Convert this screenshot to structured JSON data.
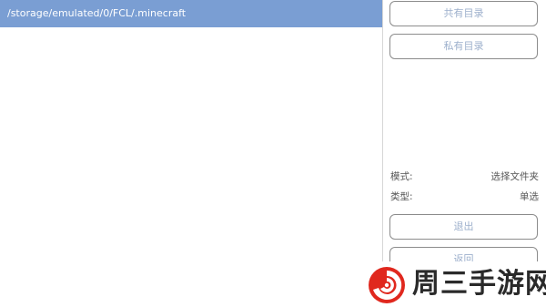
{
  "path_bar": {
    "path": "/storage/emulated/0/FCL/.minecraft"
  },
  "sidebar": {
    "public_dir_label": "共有目录",
    "private_dir_label": "私有目录",
    "mode_key": "模式:",
    "mode_value": "选择文件夹",
    "type_key": "类型:",
    "type_value": "单选",
    "exit_label": "退出",
    "back_label": "返回"
  },
  "watermark": {
    "text": "周三手游网"
  },
  "colors": {
    "path_bar_bg": "#7a9ed3",
    "button_text": "#9db0cc",
    "watermark_red": "#e0281e"
  },
  "icons": {
    "watermark_logo": "swirl-logo-icon"
  }
}
